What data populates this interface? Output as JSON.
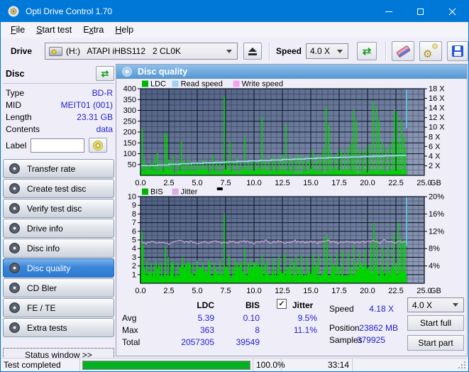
{
  "window": {
    "title": "Opti Drive Control 1.70"
  },
  "icons": {
    "refresh_arrows": "⇄",
    "gear": "⚙",
    "check": "✓"
  },
  "menu": {
    "items": [
      {
        "label": "File",
        "accel": 0
      },
      {
        "label": "Start test",
        "accel": 0
      },
      {
        "label": "Extra",
        "accel": 1
      },
      {
        "label": "Help",
        "accel": 0
      }
    ]
  },
  "toolbar": {
    "drive_label": "Drive",
    "drive_value": "(H:)   ATAPI iHBS112   2 CL0K",
    "speed_label": "Speed",
    "speed_value": "4.0 X"
  },
  "sidebar": {
    "disc_panel": {
      "title": "Disc",
      "fields": [
        [
          "Type",
          "BD-R"
        ],
        [
          "MID",
          "MEIT01 (001)"
        ],
        [
          "Length",
          "23.31 GB"
        ],
        [
          "Contents",
          "data"
        ]
      ],
      "label_row": {
        "label": "Label",
        "value": ""
      }
    },
    "buttons": [
      "Transfer rate",
      "Create test disc",
      "Verify test disc",
      "Drive info",
      "Disc info",
      "Disc quality",
      "CD Bler",
      "FE / TE",
      "Extra tests"
    ],
    "active_button": "Disc quality",
    "status_window_button": "Status window >>"
  },
  "panel": {
    "title": "Disc quality"
  },
  "chart_data": [
    {
      "id": 1,
      "type": "area",
      "legend": [
        {
          "label": "LDC",
          "color": "#00b400"
        },
        {
          "label": "Read speed",
          "color": "#9fd2f2"
        },
        {
          "label": "Write speed",
          "color": "#f6a0f0"
        }
      ],
      "x_max": 25,
      "x_major": 2.5,
      "x_minor": 0.5,
      "x_unit": "GB",
      "data_end": 23.38,
      "left": {
        "max": 400,
        "minor": 25,
        "ticks": [
          50,
          100,
          150,
          200,
          250,
          300,
          350,
          400
        ]
      },
      "right": {
        "max": 18,
        "ticks": [
          2,
          4,
          6,
          8,
          10,
          12,
          14,
          16,
          18
        ],
        "suffix": " X"
      },
      "marker": {
        "x": 23.45,
        "from": 400,
        "to": 218,
        "color": "#62d2f4"
      },
      "series": {
        "ldc": {
          "color": "#00d300",
          "base": 20,
          "spikes": [
            [
              0.15,
              212
            ],
            [
              0.32,
              78
            ],
            [
              0.5,
              52
            ],
            [
              0.7,
              46
            ],
            [
              0.9,
              62
            ],
            [
              1.1,
              52
            ],
            [
              1.3,
              82
            ],
            [
              1.5,
              102
            ],
            [
              1.7,
              62
            ],
            [
              1.9,
              56
            ],
            [
              2.15,
              196
            ],
            [
              2.32,
              186
            ],
            [
              2.5,
              72
            ],
            [
              2.7,
              62
            ],
            [
              2.9,
              92
            ],
            [
              3.1,
              56
            ],
            [
              3.35,
              66
            ],
            [
              3.6,
              156
            ],
            [
              3.8,
              72
            ],
            [
              4.0,
              52
            ],
            [
              4.2,
              76
            ],
            [
              4.5,
              62
            ],
            [
              4.75,
              56
            ],
            [
              5.0,
              64
            ],
            [
              5.25,
              56
            ],
            [
              5.5,
              72
            ],
            [
              5.8,
              66
            ],
            [
              6.1,
              60
            ],
            [
              6.4,
              94
            ],
            [
              6.7,
              62
            ],
            [
              7.0,
              66
            ],
            [
              7.38,
              363
            ],
            [
              7.6,
              72
            ],
            [
              7.9,
              152
            ],
            [
              8.2,
              62
            ],
            [
              8.5,
              80
            ],
            [
              8.8,
              56
            ],
            [
              9.2,
              178
            ],
            [
              9.5,
              66
            ],
            [
              9.8,
              62
            ],
            [
              10.1,
              72
            ],
            [
              10.4,
              66
            ],
            [
              10.7,
              268
            ],
            [
              11.0,
              76
            ],
            [
              11.3,
              62
            ],
            [
              11.6,
              92
            ],
            [
              11.9,
              72
            ],
            [
              12.2,
              82
            ],
            [
              12.5,
              96
            ],
            [
              12.8,
              232
            ],
            [
              13.1,
              86
            ],
            [
              13.4,
              72
            ],
            [
              13.7,
              92
            ],
            [
              14.0,
              96
            ],
            [
              14.3,
              82
            ],
            [
              14.6,
              76
            ],
            [
              14.9,
              92
            ],
            [
              15.2,
              112
            ],
            [
              15.5,
              86
            ],
            [
              15.8,
              96
            ],
            [
              16.1,
              122
            ],
            [
              16.35,
              316
            ],
            [
              16.55,
              232
            ],
            [
              16.8,
              102
            ],
            [
              17.1,
              92
            ],
            [
              17.4,
              112
            ],
            [
              17.7,
              122
            ],
            [
              18.0,
              102
            ],
            [
              18.3,
              132
            ],
            [
              18.6,
              152
            ],
            [
              18.78,
              302
            ],
            [
              19.0,
              252
            ],
            [
              19.3,
              122
            ],
            [
              19.6,
              112
            ],
            [
              19.9,
              132
            ],
            [
              20.2,
              142
            ],
            [
              20.5,
              342
            ],
            [
              20.78,
              312
            ],
            [
              21.0,
              256
            ],
            [
              21.3,
              152
            ],
            [
              21.6,
              122
            ],
            [
              21.9,
              142
            ],
            [
              22.2,
              162
            ],
            [
              22.38,
              302
            ],
            [
              22.6,
              286
            ],
            [
              22.8,
              152
            ],
            [
              23.0,
              252
            ],
            [
              23.2,
              182
            ],
            [
              23.32,
              122
            ]
          ]
        },
        "read_speed": {
          "color": "#a8dbf8",
          "axis": "right",
          "points": [
            [
              0,
              2.05
            ],
            [
              1.5,
              2.15
            ],
            [
              2.5,
              2.3
            ],
            [
              3.5,
              2.4
            ],
            [
              4.5,
              2.5
            ],
            [
              5.5,
              2.6
            ],
            [
              6.5,
              2.7
            ],
            [
              7.5,
              2.8
            ],
            [
              8.5,
              2.9
            ],
            [
              9.5,
              3.0
            ],
            [
              10.5,
              3.1
            ],
            [
              11.5,
              3.2
            ],
            [
              12.5,
              3.3
            ],
            [
              13.5,
              3.4
            ],
            [
              14.5,
              3.5
            ],
            [
              15.5,
              3.6
            ],
            [
              16.5,
              3.68
            ],
            [
              17.5,
              3.76
            ],
            [
              18.5,
              3.84
            ],
            [
              19.5,
              3.92
            ],
            [
              20.5,
              4.0
            ],
            [
              21.5,
              4.07
            ],
            [
              22.5,
              4.13
            ],
            [
              23.38,
              4.18
            ]
          ]
        }
      }
    },
    {
      "id": 2,
      "type": "area",
      "legend": [
        {
          "label": "BIS",
          "color": "#00b400"
        },
        {
          "label": "Jitter",
          "color": "#d9aede"
        }
      ],
      "legend_dash": true,
      "x_max": 25,
      "x_major": 2.5,
      "x_minor": 0.5,
      "x_unit": "GB",
      "data_end": 23.38,
      "left": {
        "max": 10,
        "minor": 0.5,
        "ticks": [
          1,
          2,
          3,
          4,
          5,
          6,
          7,
          8,
          9,
          10
        ]
      },
      "right": {
        "max": 20,
        "ticks": [
          4,
          8,
          12,
          16,
          20
        ],
        "suffix": "%"
      },
      "marker": {
        "x": 23.45,
        "from": 10,
        "to": 4.3,
        "color": "#62d2f4"
      },
      "series": {
        "bis": {
          "color": "#00d300",
          "base": 1.5,
          "spikes": [
            [
              0.12,
              6
            ],
            [
              0.22,
              4.4
            ],
            [
              0.55,
              2.6
            ],
            [
              0.95,
              2.3
            ],
            [
              1.4,
              2.6
            ],
            [
              1.85,
              2.4
            ],
            [
              2.2,
              4.2
            ],
            [
              2.45,
              3.0
            ],
            [
              2.9,
              2.6
            ],
            [
              3.3,
              2.3
            ],
            [
              3.7,
              3.0
            ],
            [
              4.1,
              2.5
            ],
            [
              4.6,
              2.3
            ],
            [
              5.0,
              2.6
            ],
            [
              5.5,
              2.4
            ],
            [
              6.0,
              2.7
            ],
            [
              6.5,
              2.5
            ],
            [
              7.0,
              2.6
            ],
            [
              7.38,
              8
            ],
            [
              7.8,
              3.2
            ],
            [
              8.3,
              2.7
            ],
            [
              8.8,
              2.5
            ],
            [
              9.2,
              4.0
            ],
            [
              9.7,
              2.6
            ],
            [
              10.2,
              2.7
            ],
            [
              10.7,
              3.3
            ],
            [
              11.2,
              2.6
            ],
            [
              11.7,
              2.9
            ],
            [
              12.2,
              3.1
            ],
            [
              12.7,
              3.5
            ],
            [
              13.2,
              2.9
            ],
            [
              13.7,
              3.1
            ],
            [
              14.2,
              3.3
            ],
            [
              14.7,
              3.0
            ],
            [
              15.2,
              3.5
            ],
            [
              15.7,
              3.2
            ],
            [
              16.2,
              5.2
            ],
            [
              16.45,
              5.6
            ],
            [
              16.8,
              3.3
            ],
            [
              17.3,
              3.5
            ],
            [
              17.8,
              3.9
            ],
            [
              18.3,
              3.6
            ],
            [
              18.8,
              4.3
            ],
            [
              19.3,
              3.7
            ],
            [
              19.8,
              3.9
            ],
            [
              20.3,
              4.6
            ],
            [
              20.55,
              7.0
            ],
            [
              20.8,
              5.1
            ],
            [
              21.3,
              4.1
            ],
            [
              21.8,
              4.3
            ],
            [
              22.3,
              5.6
            ],
            [
              22.7,
              7.0
            ],
            [
              22.95,
              5.2
            ],
            [
              23.15,
              4.6
            ],
            [
              23.3,
              5.0
            ]
          ]
        },
        "jitter": {
          "color": "#d9aede",
          "x_step": 0.5,
          "values": [
            4.8,
            4.65,
            4.9,
            4.7,
            4.85,
            4.6,
            4.75,
            4.9,
            4.7,
            4.8,
            4.65,
            4.85,
            4.7,
            4.95,
            4.75,
            4.6,
            4.85,
            4.7,
            4.9,
            4.75,
            4.65,
            4.8,
            4.9,
            4.7,
            4.85,
            4.75,
            4.6,
            4.9,
            4.8,
            4.7,
            4.85,
            4.65,
            4.8,
            4.9,
            4.75,
            4.7,
            4.85,
            4.8,
            4.65,
            4.9,
            4.75,
            4.8,
            4.7,
            4.9,
            4.85,
            4.75,
            4.8,
            4.7
          ]
        }
      }
    }
  ],
  "stats": {
    "columns": [
      "LDC",
      "BIS"
    ],
    "jitter": {
      "label": "Jitter",
      "checked": true
    },
    "rows": [
      [
        "Avg",
        "5.39",
        "0.10",
        "9.5%"
      ],
      [
        "Max",
        "363",
        "8",
        "11.1%"
      ],
      [
        "Total",
        "2057305",
        "39549",
        ""
      ]
    ]
  },
  "test_controls": {
    "speed_label": "Speed",
    "speed_value": "4.18 X",
    "position_label": "Position",
    "position_value": "23862 MB",
    "samples_label": "Samples",
    "samples_value": "379925",
    "speed_select": "4.0 X",
    "start_full": "Start full",
    "start_part": "Start part"
  },
  "statusbar": {
    "status": "Test completed",
    "percent": "100.0%",
    "progress_value": 100,
    "time": "33:14"
  },
  "colors": {
    "titlebar": "#0078d7",
    "value_text": "#2121cc",
    "progress_green": "#06b025",
    "ldc_green": "#00d300",
    "read_speed_blue": "#a8dbf8",
    "write_speed_pink": "#f6a0f0",
    "jitter_pink": "#d9aede",
    "plot_bg_top": "#4e5f82",
    "plot_bg_bottom": "#8795b4"
  }
}
